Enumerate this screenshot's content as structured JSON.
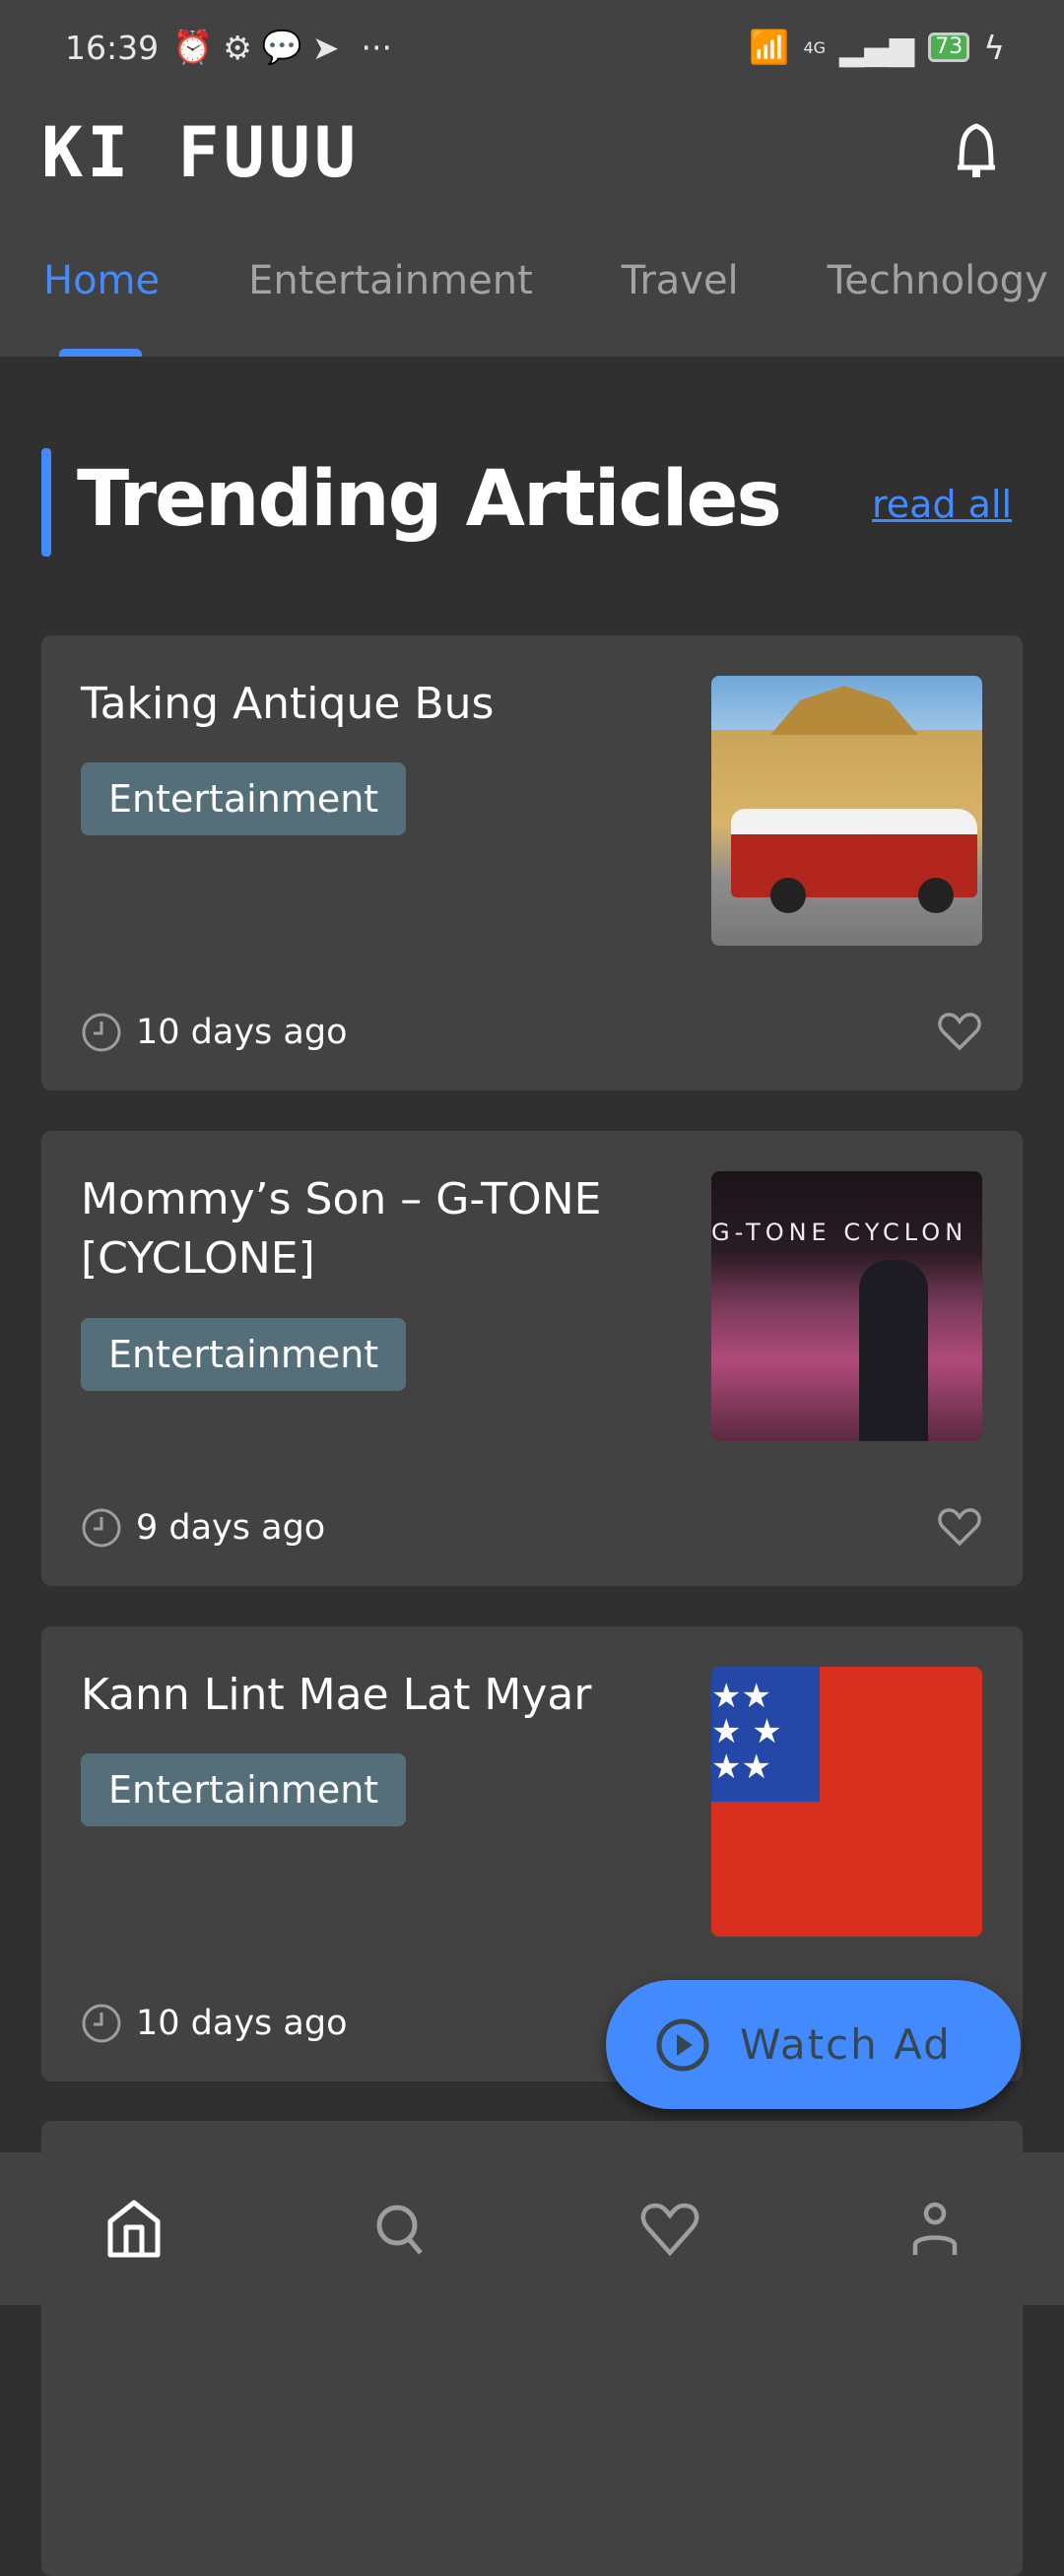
{
  "status_bar": {
    "time": "16:39",
    "battery": "73",
    "network": "4G"
  },
  "header": {
    "logo": "KI FUUU",
    "notification_icon": "bell-icon"
  },
  "tabs": [
    {
      "label": "Home",
      "active": true
    },
    {
      "label": "Entertainment"
    },
    {
      "label": "Travel"
    },
    {
      "label": "Technology"
    }
  ],
  "section": {
    "title": "Trending Articles",
    "read_all": "read all"
  },
  "articles": [
    {
      "title": "Taking Antique Bus",
      "category": "Entertainment",
      "time": "10 days ago",
      "image": "antique-bus-photo"
    },
    {
      "title": "Mommy’s Son – G-TONE [CYCLONE]",
      "category": "Entertainment",
      "time": "9 days ago",
      "image": "concert-photo",
      "image_text": "G-TONE CYCLON"
    },
    {
      "title": "Kann Lint Mae Lat Myar",
      "category": "Entertainment",
      "time": "10 days ago",
      "image": "flag-image"
    }
  ],
  "fab": {
    "label": "Watch Ad",
    "icon": "play-circle-icon"
  },
  "bottom_nav": [
    {
      "name": "home",
      "active": true
    },
    {
      "name": "search"
    },
    {
      "name": "favorites"
    },
    {
      "name": "profile"
    }
  ],
  "colors": {
    "accent": "#448aff",
    "tag": "#546e7a",
    "card": "#424242",
    "background": "#303030"
  }
}
